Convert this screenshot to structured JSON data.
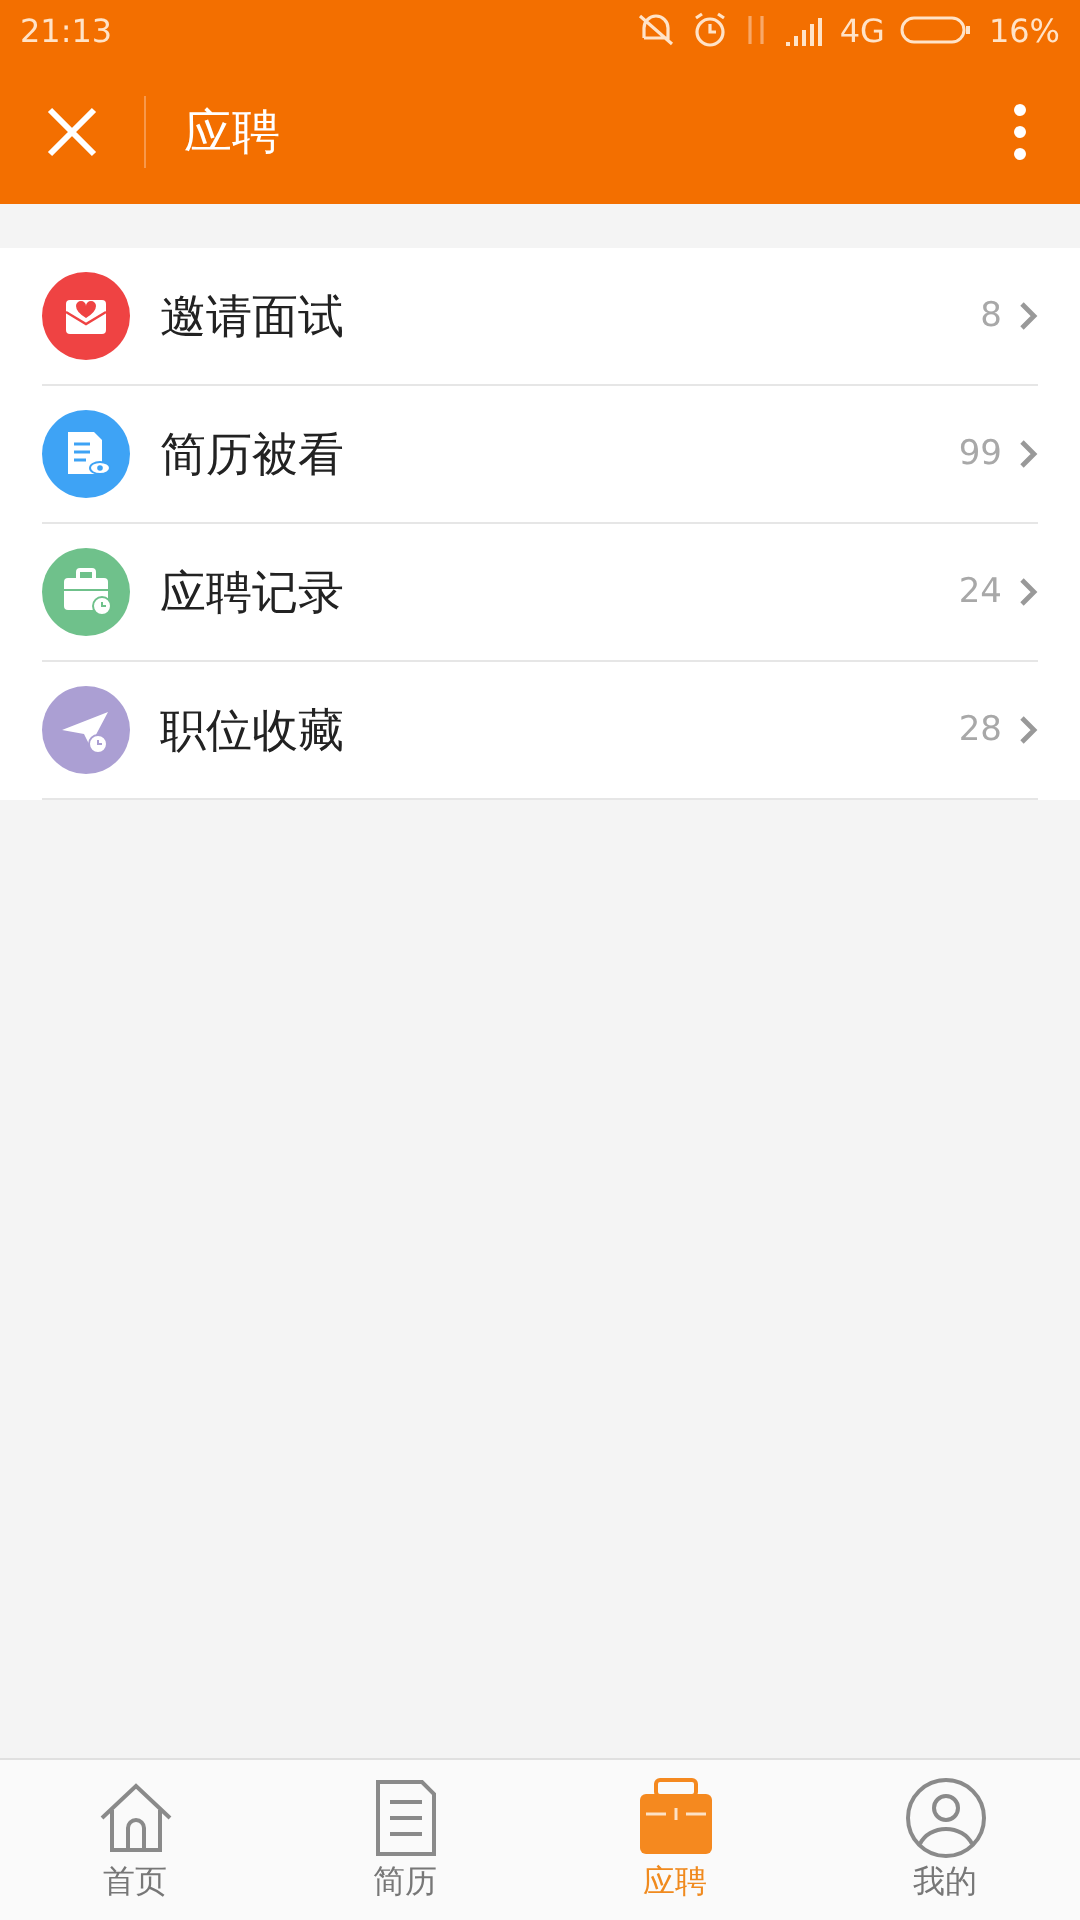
{
  "status_bar": {
    "time": "21:13",
    "network": "4G",
    "battery": "16%"
  },
  "header": {
    "title": "应聘"
  },
  "items": [
    {
      "label": "邀请面试",
      "count": "8",
      "kind": "envelope",
      "color": "#ef4343"
    },
    {
      "label": "简历被看",
      "count": "99",
      "kind": "document",
      "color": "#3ea3f5"
    },
    {
      "label": "应聘记录",
      "count": "24",
      "kind": "briefcase",
      "color": "#6fc18b"
    },
    {
      "label": "职位收藏",
      "count": "28",
      "kind": "plane",
      "color": "#ab9fd3"
    }
  ],
  "tabs": [
    {
      "label": "首页",
      "kind": "home",
      "selected": false
    },
    {
      "label": "简历",
      "kind": "document",
      "selected": false
    },
    {
      "label": "应聘",
      "kind": "briefcase",
      "selected": true
    },
    {
      "label": "我的",
      "kind": "person",
      "selected": false
    }
  ]
}
